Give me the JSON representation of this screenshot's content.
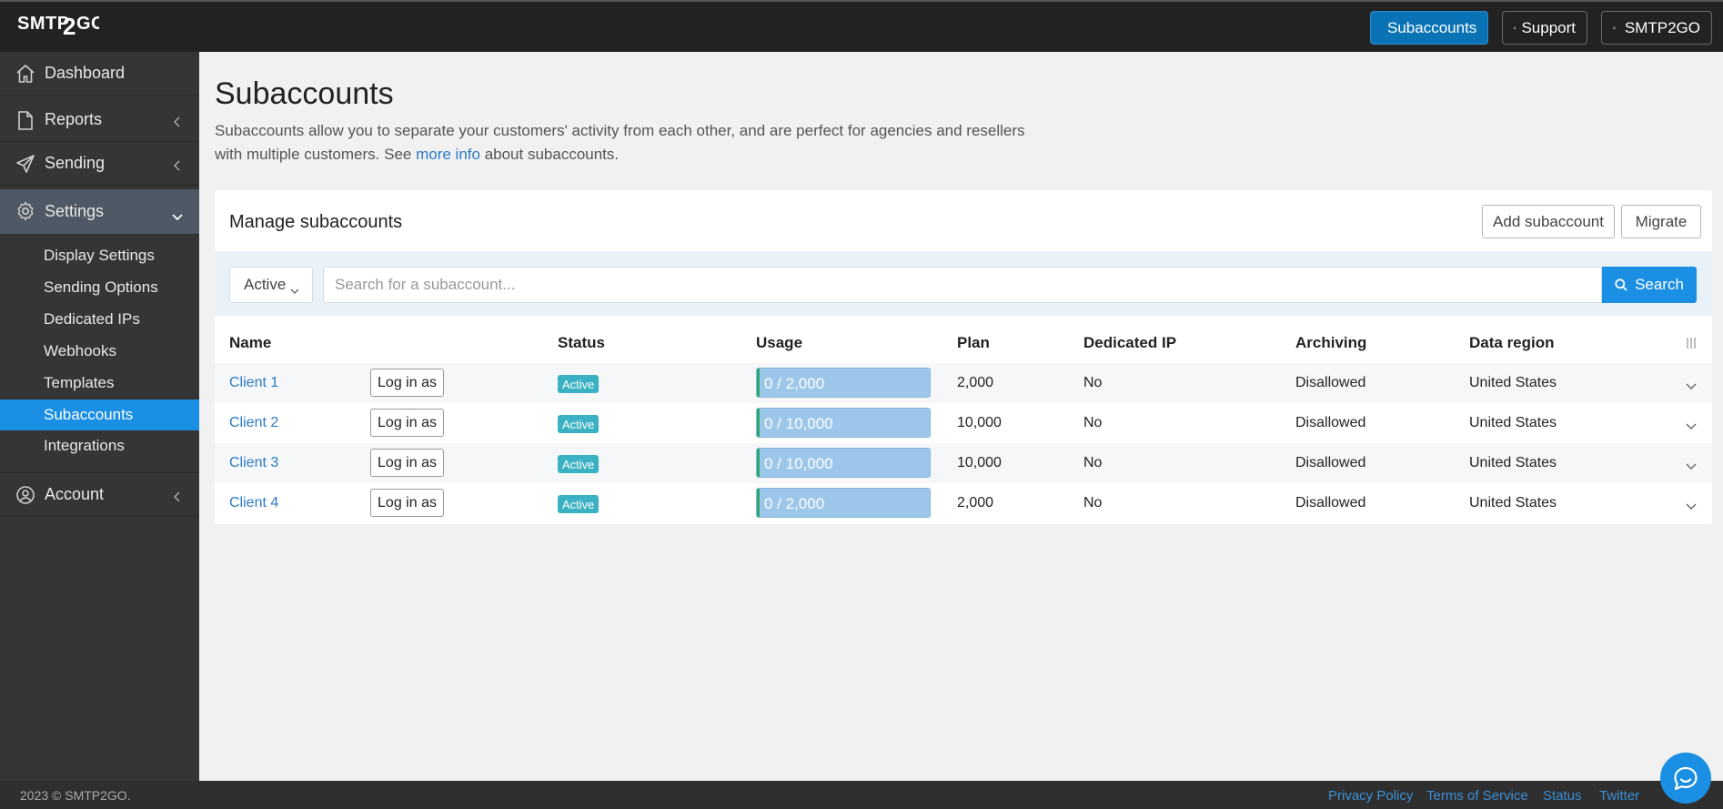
{
  "topbar": {
    "logo_text": "SMTP2GO",
    "subaccounts_label": "Subaccounts",
    "support_label": "Support",
    "account_label": "SMTP2GO",
    "primary_color": "#0a73b6"
  },
  "sidebar": {
    "items": [
      {
        "label": "Dashboard",
        "icon": "home-icon"
      },
      {
        "label": "Reports",
        "icon": "document-icon"
      },
      {
        "label": "Sending",
        "icon": "paper-plane-icon"
      },
      {
        "label": "Settings",
        "icon": "gear-icon"
      },
      {
        "label": "Account",
        "icon": "user-circle-icon"
      }
    ],
    "settings_sub": [
      "Display Settings",
      "Sending Options",
      "Dedicated IPs",
      "Webhooks",
      "Templates",
      "Subaccounts",
      "Integrations"
    ]
  },
  "main": {
    "title": "Subaccounts",
    "intro_before": "Subaccounts allow you to separate your customers' activity from each other, and are perfect for agencies and resellers with multiple customers. See ",
    "intro_link": "more info",
    "intro_after": " about subaccounts."
  },
  "card": {
    "title": "Manage subaccounts",
    "add_label": "Add subaccount",
    "migrate_label": "Migrate",
    "filter_value": "Active",
    "search_placeholder": "Search for a subaccount...",
    "search_label": "Search",
    "columns": [
      "Name",
      "Status",
      "Usage",
      "Plan",
      "Dedicated IP",
      "Archiving",
      "Data region"
    ],
    "login_label": "Log in as",
    "rows": [
      {
        "name": "Client 1",
        "status": "Active",
        "usage": "0 / 2,000",
        "usage_fraction": 0,
        "plan": "2,000",
        "dedicated_ip": "No",
        "archiving": "Disallowed",
        "region": "United States"
      },
      {
        "name": "Client 2",
        "status": "Active",
        "usage": "0 / 10,000",
        "usage_fraction": 0,
        "plan": "10,000",
        "dedicated_ip": "No",
        "archiving": "Disallowed",
        "region": "United States"
      },
      {
        "name": "Client 3",
        "status": "Active",
        "usage": "0 / 10,000",
        "usage_fraction": 0,
        "plan": "10,000",
        "dedicated_ip": "No",
        "archiving": "Disallowed",
        "region": "United States"
      },
      {
        "name": "Client 4",
        "status": "Active",
        "usage": "0 / 2,000",
        "usage_fraction": 0,
        "plan": "2,000",
        "dedicated_ip": "No",
        "archiving": "Disallowed",
        "region": "United States"
      }
    ]
  },
  "footer": {
    "copyright": "2023 © SMTP2GO.",
    "links": [
      "Privacy Policy",
      "Terms of Service",
      "Status",
      "Twitter"
    ]
  }
}
